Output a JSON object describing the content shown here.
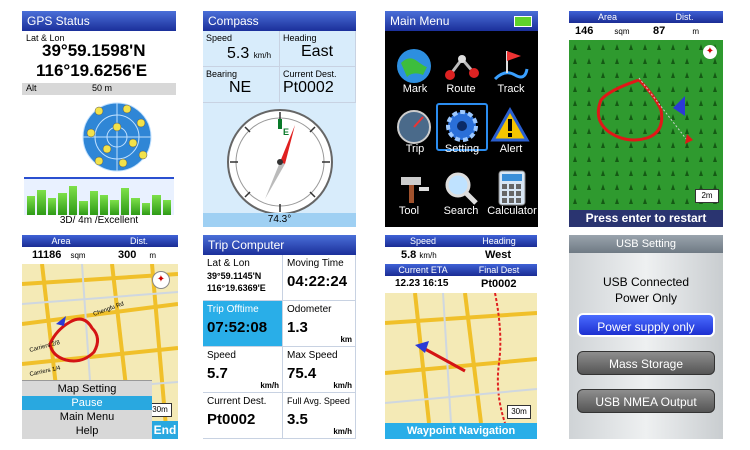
{
  "gps_status": {
    "title": "GPS Status",
    "latlon_label": "Lat & Lon",
    "lat": "39°59.1598'N",
    "lon": "116°19.6256'E",
    "alt_label": "Alt",
    "alt_value": "50 m",
    "fix_text": "3D/ 4m  /Excellent",
    "signal_bars": [
      0.55,
      0.75,
      0.5,
      0.65,
      0.85,
      0.4,
      0.7,
      0.6,
      0.45,
      0.8,
      0.5,
      0.35,
      0.6,
      0.45
    ]
  },
  "compass": {
    "title": "Compass",
    "speed_label": "Speed",
    "speed_value": "5.3",
    "speed_unit": "km/h",
    "heading_label": "Heading",
    "heading_value": "East",
    "bearing_label": "Bearing",
    "bearing_value": "NE",
    "dest_label": "Current Dest.",
    "dest_value": "Pt0002",
    "degrees": "74.3°"
  },
  "main_menu": {
    "title": "Main Menu",
    "items": [
      "Mark",
      "Route",
      "Track",
      "Trip",
      "Setting",
      "Alert",
      "Tool",
      "Search",
      "Calculator"
    ]
  },
  "area_map": {
    "area_label": "Area",
    "dist_label": "Dist.",
    "area_value": "146",
    "area_unit": "sqm",
    "dist_value": "87",
    "dist_unit": "m",
    "scale": "2m",
    "footer": "Press enter to restart"
  },
  "area_context": {
    "area_label": "Area",
    "dist_label": "Dist.",
    "area_value": "11186",
    "area_unit": "sqm",
    "dist_value": "300",
    "dist_unit": "m",
    "scale": "30m",
    "menu": [
      "Map Setting",
      "Pause",
      "Main Menu",
      "Help"
    ],
    "end_label": "End",
    "streets": [
      "Chengfu Rd",
      "Carriers 2/8",
      "Carriers 1/4",
      "Jingxin Rd"
    ]
  },
  "trip_computer": {
    "title": "Trip Computer",
    "latlon_label": "Lat & Lon",
    "lat": "39°59.1145'N",
    "lon": "116°19.6369'E",
    "moving_label": "Moving Time",
    "moving_value": "04:22:24",
    "offtime_label": "Trip Offtime",
    "offtime_value": "07:52:08",
    "odometer_label": "Odometer",
    "odometer_value": "1.3",
    "odometer_unit": "km",
    "speed_label": "Speed",
    "speed_value": "5.7",
    "speed_unit": "km/h",
    "max_speed_label": "Max Speed",
    "max_speed_value": "75.4",
    "max_speed_unit": "km/h",
    "dest_label": "Current Dest.",
    "dest_value": "Pt0002",
    "avg_label": "Full Avg. Speed",
    "avg_value": "3.5",
    "avg_unit": "km/h"
  },
  "waypoint_nav": {
    "speed_label": "Speed",
    "heading_label": "Heading",
    "speed_value": "5.8",
    "speed_unit": "km/h",
    "heading_value": "West",
    "eta_label": "Current ETA",
    "final_label": "Final Dest",
    "eta_value": "12.23 16:15",
    "final_value": "Pt0002",
    "scale": "30m",
    "footer": "Waypoint  Navigation"
  },
  "usb_setting": {
    "title": "USB Setting",
    "status_line1": "USB Connected",
    "status_line2": "Power Only",
    "buttons": [
      "Power supply only",
      "Mass Storage",
      "USB NMEA Output"
    ]
  }
}
